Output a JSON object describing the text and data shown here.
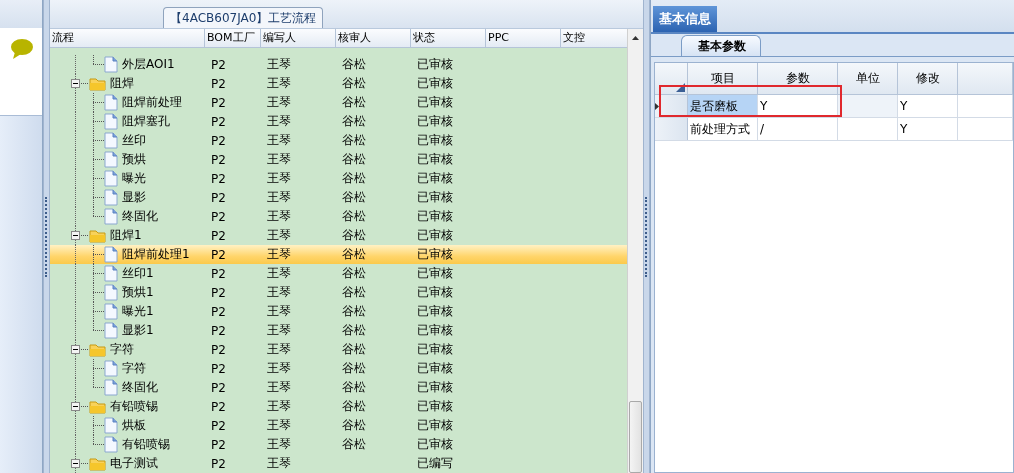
{
  "flow_panel": {
    "title": "【4ACB607JA0】工艺流程",
    "columns": [
      "流程",
      "BOM工厂",
      "编写人",
      "核审人",
      "状态",
      "PPC",
      "文控"
    ],
    "rows": [
      {
        "kind": "continued",
        "children": [
          {
            "name": "外层AOI1",
            "bom": "P2",
            "author": "王琴",
            "reviewer": "谷松",
            "status": "已审核",
            "selected": false
          }
        ]
      },
      {
        "kind": "folder",
        "name": "阻焊",
        "bom": "P2",
        "author": "王琴",
        "reviewer": "谷松",
        "status": "已审核",
        "expanded": true,
        "selected": false,
        "children": [
          {
            "name": "阻焊前处理",
            "bom": "P2",
            "author": "王琴",
            "reviewer": "谷松",
            "status": "已审核",
            "selected": false
          },
          {
            "name": "阻焊塞孔",
            "bom": "P2",
            "author": "王琴",
            "reviewer": "谷松",
            "status": "已审核",
            "selected": false
          },
          {
            "name": "丝印",
            "bom": "P2",
            "author": "王琴",
            "reviewer": "谷松",
            "status": "已审核",
            "selected": false
          },
          {
            "name": "预烘",
            "bom": "P2",
            "author": "王琴",
            "reviewer": "谷松",
            "status": "已审核",
            "selected": false
          },
          {
            "name": "曝光",
            "bom": "P2",
            "author": "王琴",
            "reviewer": "谷松",
            "status": "已审核",
            "selected": false
          },
          {
            "name": "显影",
            "bom": "P2",
            "author": "王琴",
            "reviewer": "谷松",
            "status": "已审核",
            "selected": false
          },
          {
            "name": "终固化",
            "bom": "P2",
            "author": "王琴",
            "reviewer": "谷松",
            "status": "已审核",
            "selected": false
          }
        ]
      },
      {
        "kind": "folder",
        "name": "阻焊1",
        "bom": "P2",
        "author": "王琴",
        "reviewer": "谷松",
        "status": "已审核",
        "expanded": true,
        "selected": false,
        "children": [
          {
            "name": "阻焊前处理1",
            "bom": "P2",
            "author": "王琴",
            "reviewer": "谷松",
            "status": "已审核",
            "selected": true
          },
          {
            "name": "丝印1",
            "bom": "P2",
            "author": "王琴",
            "reviewer": "谷松",
            "status": "已审核",
            "selected": false
          },
          {
            "name": "预烘1",
            "bom": "P2",
            "author": "王琴",
            "reviewer": "谷松",
            "status": "已审核",
            "selected": false
          },
          {
            "name": "曝光1",
            "bom": "P2",
            "author": "王琴",
            "reviewer": "谷松",
            "status": "已审核",
            "selected": false
          },
          {
            "name": "显影1",
            "bom": "P2",
            "author": "王琴",
            "reviewer": "谷松",
            "status": "已审核",
            "selected": false
          }
        ]
      },
      {
        "kind": "folder",
        "name": "字符",
        "bom": "P2",
        "author": "王琴",
        "reviewer": "谷松",
        "status": "已审核",
        "expanded": true,
        "selected": false,
        "children": [
          {
            "name": "字符",
            "bom": "P2",
            "author": "王琴",
            "reviewer": "谷松",
            "status": "已审核",
            "selected": false
          },
          {
            "name": "终固化",
            "bom": "P2",
            "author": "王琴",
            "reviewer": "谷松",
            "status": "已审核",
            "selected": false
          }
        ]
      },
      {
        "kind": "folder",
        "name": "有铅喷锡",
        "bom": "P2",
        "author": "王琴",
        "reviewer": "谷松",
        "status": "已审核",
        "expanded": true,
        "selected": false,
        "children": [
          {
            "name": "烘板",
            "bom": "P2",
            "author": "王琴",
            "reviewer": "谷松",
            "status": "已审核",
            "selected": false
          },
          {
            "name": "有铅喷锡",
            "bom": "P2",
            "author": "王琴",
            "reviewer": "谷松",
            "status": "已审核",
            "selected": false
          }
        ]
      },
      {
        "kind": "folder",
        "name": "电子测试",
        "bom": "P2",
        "author": "王琴",
        "status": "已编写",
        "expanded": true,
        "selected": false
      }
    ]
  },
  "info_panel": {
    "tabs": [
      {
        "label": "基本信息",
        "selected": true
      }
    ],
    "subtabs": [
      {
        "label": "基本参数",
        "selected": true
      }
    ],
    "columns": [
      "项目",
      "参数",
      "单位",
      "修改"
    ],
    "rows": [
      {
        "item": "是否磨板",
        "param": "Y",
        "modified": "Y",
        "selected": true
      },
      {
        "item": "前处理方式",
        "param": "/",
        "modified": "Y",
        "selected": false
      }
    ]
  }
}
